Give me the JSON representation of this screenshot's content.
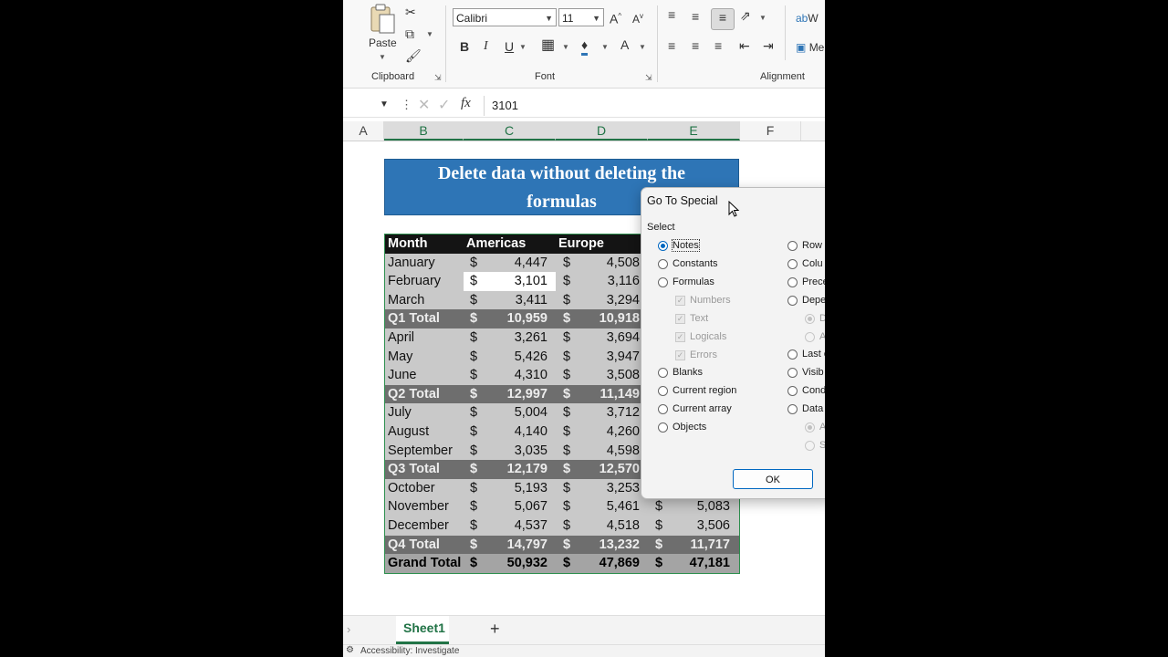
{
  "ribbon": {
    "clipboard": {
      "group_label": "Clipboard",
      "paste_label": "Paste"
    },
    "font": {
      "group_label": "Font",
      "font_name": "Calibri",
      "font_size": "11",
      "bold": "B",
      "italic": "I",
      "underline": "U",
      "grow": "A",
      "shrink": "A",
      "font_color": "A"
    },
    "alignment": {
      "group_label": "Alignment",
      "wrap_label": "W",
      "merge_label": "Me"
    }
  },
  "formula_bar": {
    "fx_label": "fx",
    "value": "3101"
  },
  "columns": [
    "A",
    "B",
    "C",
    "D",
    "E",
    "F"
  ],
  "sheet": {
    "title_line1": "Delete data without deleting the",
    "title_line2": "formulas",
    "header": {
      "month": "Month",
      "americas": "Americas",
      "europe": "Europe"
    },
    "currency": "$",
    "rows": [
      {
        "month": "January",
        "americas": "4,447",
        "europe": "4,508",
        "e": ""
      },
      {
        "month": "February",
        "americas": "3,101",
        "europe": "3,116",
        "e": ""
      },
      {
        "month": "March",
        "americas": "3,411",
        "europe": "3,294",
        "e": ""
      },
      {
        "month": "Q1 Total",
        "americas": "10,959",
        "europe": "10,918",
        "e": ""
      },
      {
        "month": "April",
        "americas": "3,261",
        "europe": "3,694",
        "e": ""
      },
      {
        "month": "May",
        "americas": "5,426",
        "europe": "3,947",
        "e": ""
      },
      {
        "month": "June",
        "americas": "4,310",
        "europe": "3,508",
        "e": ""
      },
      {
        "month": "Q2 Total",
        "americas": "12,997",
        "europe": "11,149",
        "e": ""
      },
      {
        "month": "July",
        "americas": "5,004",
        "europe": "3,712",
        "e": ""
      },
      {
        "month": "August",
        "americas": "4,140",
        "europe": "4,260",
        "e": ""
      },
      {
        "month": "September",
        "americas": "3,035",
        "europe": "4,598",
        "e": ""
      },
      {
        "month": "Q3 Total",
        "americas": "12,179",
        "europe": "12,570",
        "e": ""
      },
      {
        "month": "October",
        "americas": "5,193",
        "europe": "3,253",
        "e": ""
      },
      {
        "month": "November",
        "americas": "5,067",
        "europe": "5,461",
        "e": "5,083"
      },
      {
        "month": "December",
        "americas": "4,537",
        "europe": "4,518",
        "e": "3,506"
      },
      {
        "month": "Q4 Total",
        "americas": "14,797",
        "europe": "13,232",
        "e": "11,717"
      },
      {
        "month": "Grand Total",
        "americas": "50,932",
        "europe": "47,869",
        "e": "47,181"
      }
    ]
  },
  "dialog": {
    "title": "Go To Special",
    "select_label": "Select",
    "left_options": [
      "Notes",
      "Constants",
      "Formulas",
      "Blanks",
      "Current region",
      "Current array",
      "Objects"
    ],
    "formula_sub": [
      "Numbers",
      "Text",
      "Logicals",
      "Errors"
    ],
    "right_options": [
      "Row d",
      "Colu",
      "Prece",
      "Depe",
      "Last c",
      "Visib",
      "Cond",
      "Data"
    ],
    "right_sub": [
      "D",
      "A",
      "A",
      "S"
    ],
    "ok_label": "OK"
  },
  "tabs": {
    "sheet_name": "Sheet1",
    "add_label": "+"
  },
  "status": {
    "accessibility": "Accessibility: Investigate"
  }
}
